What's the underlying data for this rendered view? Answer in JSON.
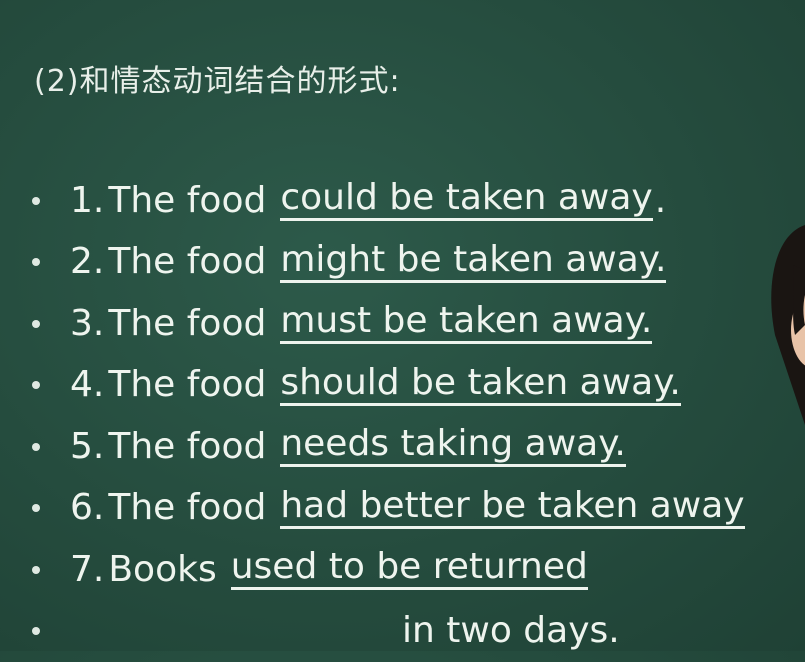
{
  "title": "(2)和情态动词结合的形式:",
  "items": [
    {
      "num": "1.",
      "subject": "The food",
      "answer": "could be taken away",
      "tail": "."
    },
    {
      "num": "2.",
      "subject": "The food",
      "answer": "might be taken away.",
      "tail": ""
    },
    {
      "num": "3.",
      "subject": "The food",
      "answer": "must be taken away.",
      "tail": ""
    },
    {
      "num": "4.",
      "subject": "The food",
      "answer": "should be taken away.",
      "tail": ""
    },
    {
      "num": "5.",
      "subject": "The food",
      "answer": "needs taking away.",
      "tail": ""
    },
    {
      "num": "6.",
      "subject": "The food",
      "answer": "had better be taken away",
      "tail": ""
    },
    {
      "num": "7.",
      "subject": "Books",
      "answer": "used to be returned",
      "tail": ""
    },
    {
      "num": "",
      "subject": "",
      "answer": "",
      "tail": "in two days."
    }
  ]
}
